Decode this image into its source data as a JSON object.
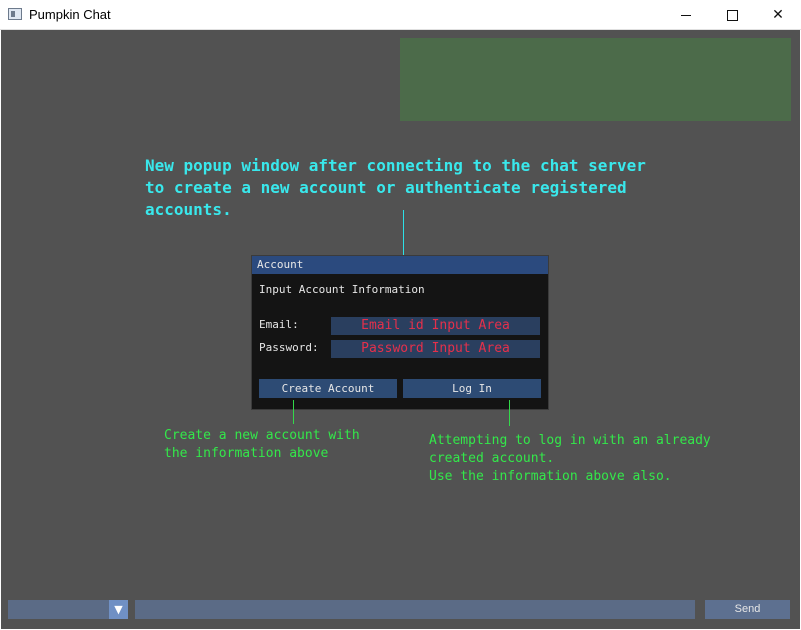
{
  "window": {
    "title": "Pumpkin Chat"
  },
  "annotations": {
    "popup_note": "New popup window after connecting to the chat server\nto create a new account or authenticate registered\naccounts.",
    "create_note": "Create a new account with\nthe information above",
    "login_note": "Attempting to log in with an already\ncreated account.\nUse the information above also."
  },
  "dialog": {
    "title": "Account",
    "heading": "Input Account Information",
    "email_label": "Email:",
    "email_value": "Email id Input Area",
    "password_label": "Password:",
    "password_value": "Password Input Area",
    "create_button": "Create Account",
    "login_button": "Log In"
  },
  "bottom_bar": {
    "dropdown_value": "",
    "message_value": "",
    "send_label": "Send"
  },
  "icons": {
    "app": "app-window-icon",
    "minimize": "minimize-icon",
    "maximize": "maximize-icon",
    "close": "close-icon",
    "dropdown": "triangle-down-icon"
  },
  "colors": {
    "background": "#525252",
    "status_panel": "#4c6b4a",
    "annotation_cyan": "#39e8ec",
    "annotation_green": "#33e84a",
    "dialog_title": "#2b4a7e",
    "field_text": "#e5304b"
  }
}
